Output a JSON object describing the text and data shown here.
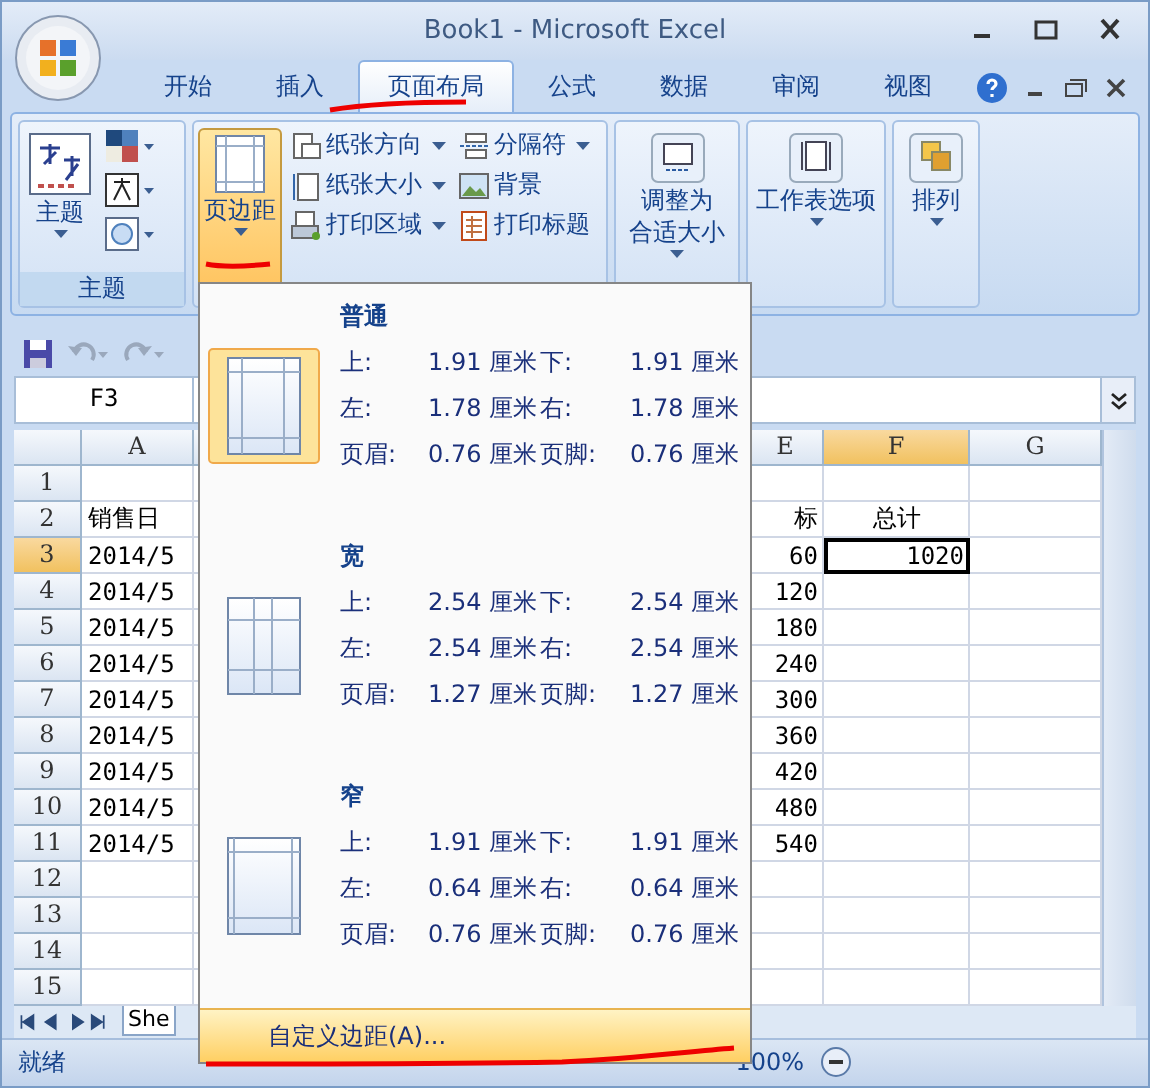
{
  "window": {
    "title": "Book1 - Microsoft Excel"
  },
  "ribbon_tabs": [
    {
      "label": "开始",
      "selected": false
    },
    {
      "label": "插入",
      "selected": false
    },
    {
      "label": "页面布局",
      "selected": true
    },
    {
      "label": "公式",
      "selected": false
    },
    {
      "label": "数据",
      "selected": false
    },
    {
      "label": "审阅",
      "selected": false
    },
    {
      "label": "视图",
      "selected": false
    }
  ],
  "theme_group": {
    "button": "主题",
    "label": "主题"
  },
  "page_setup": {
    "margins_button": {
      "label": "页边距",
      "expanded": true
    },
    "commands": [
      {
        "label": "纸张方向",
        "dropdown": true,
        "kind": "orientation"
      },
      {
        "label": "分隔符",
        "dropdown": true,
        "kind": "breaks"
      },
      {
        "label": "纸张大小",
        "dropdown": true,
        "kind": "size"
      },
      {
        "label": "背景",
        "dropdown": false,
        "kind": "background"
      },
      {
        "label": "打印区域",
        "dropdown": true,
        "kind": "area"
      },
      {
        "label": "打印标题",
        "dropdown": false,
        "kind": "titles"
      }
    ]
  },
  "scale_group": {
    "button_lines": [
      "调整为",
      "合适大小"
    ]
  },
  "sheet_options_group": {
    "button": "工作表选项"
  },
  "arrange_group": {
    "button": "排列"
  },
  "name_box": "F3",
  "columns": [
    {
      "label": "A",
      "selected": false
    },
    {
      "label": "E",
      "selected": false
    },
    {
      "label": "F",
      "selected": true
    },
    {
      "label": "G",
      "selected": false
    }
  ],
  "rows": [
    {
      "number": "1",
      "selected": false
    },
    {
      "number": "2",
      "selected": false,
      "a": "销售日",
      "e": "标",
      "f": "总计"
    },
    {
      "number": "3",
      "selected": true,
      "a": "2014/5",
      "e": "60",
      "f": "1020"
    },
    {
      "number": "4",
      "selected": false,
      "a": "2014/5",
      "e": "120"
    },
    {
      "number": "5",
      "selected": false,
      "a": "2014/5",
      "e": "180"
    },
    {
      "number": "6",
      "selected": false,
      "a": "2014/5",
      "e": "240"
    },
    {
      "number": "7",
      "selected": false,
      "a": "2014/5",
      "e": "300"
    },
    {
      "number": "8",
      "selected": false,
      "a": "2014/5",
      "e": "360"
    },
    {
      "number": "9",
      "selected": false,
      "a": "2014/5",
      "e": "420"
    },
    {
      "number": "10",
      "selected": false,
      "a": "2014/5",
      "e": "480"
    },
    {
      "number": "11",
      "selected": false,
      "a": "2014/5",
      "e": "540"
    },
    {
      "number": "12",
      "selected": false
    },
    {
      "number": "13",
      "selected": false
    },
    {
      "number": "14",
      "selected": false
    },
    {
      "number": "15",
      "selected": false
    }
  ],
  "sheet_tabs": [
    {
      "label": "She",
      "selected": true
    }
  ],
  "status_bar": {
    "status": "就绪",
    "zoom": "100%"
  },
  "margins_menu": {
    "presets": [
      {
        "title": "普通",
        "selected": true,
        "kind": "normal",
        "rows": [
          [
            "上:",
            "1.91 厘米",
            "下:",
            "1.91 厘米"
          ],
          [
            "左:",
            "1.78 厘米",
            "右:",
            "1.78 厘米"
          ],
          [
            "页眉:",
            "0.76 厘米",
            "页脚:",
            "0.76 厘米"
          ]
        ]
      },
      {
        "title": "宽",
        "selected": false,
        "kind": "wide",
        "rows": [
          [
            "上:",
            "2.54 厘米",
            "下:",
            "2.54 厘米"
          ],
          [
            "左:",
            "2.54 厘米",
            "右:",
            "2.54 厘米"
          ],
          [
            "页眉:",
            "1.27 厘米",
            "页脚:",
            "1.27 厘米"
          ]
        ]
      },
      {
        "title": "窄",
        "selected": false,
        "kind": "narrow",
        "rows": [
          [
            "上:",
            "1.91 厘米",
            "下:",
            "1.91 厘米"
          ],
          [
            "左:",
            "0.64 厘米",
            "右:",
            "0.64 厘米"
          ],
          [
            "页眉:",
            "0.76 厘米",
            "页脚:",
            "0.76 厘米"
          ]
        ]
      }
    ],
    "custom": {
      "label": "自定义边距(A)...",
      "selected": true
    }
  }
}
